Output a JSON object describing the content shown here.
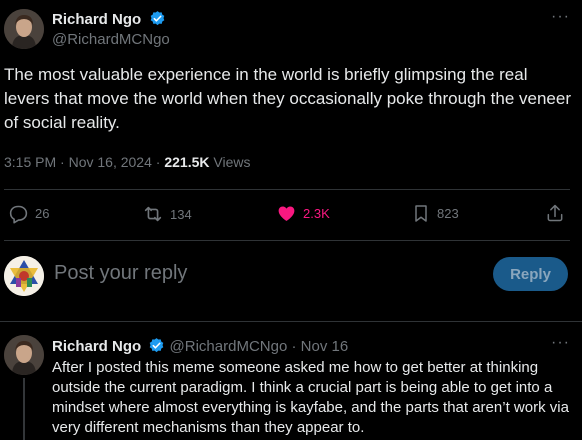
{
  "author": {
    "name": "Richard Ngo",
    "handle": "@RichardMCNgo"
  },
  "tweet": {
    "text": "The most valuable experience in the world is briefly glimpsing the real levers that move the world when they occasionally poke through the veneer of social reality.",
    "time": "3:15 PM",
    "date": "Nov 16, 2024",
    "views_count": "221.5K",
    "views_label": "Views"
  },
  "actions": {
    "replies": "26",
    "reposts": "134",
    "likes": "2.3K",
    "bookmarks": "823"
  },
  "composer": {
    "placeholder": "Post your reply",
    "button_label": "Reply"
  },
  "reply_tweet": {
    "name": "Richard Ngo",
    "handle": "@RichardMCNgo",
    "date": "Nov 16",
    "text": "After I posted this meme someone asked me how to get better at thinking outside the current paradigm. I think a crucial part is being able to get into a mindset where almost everything is kayfabe, and the parts that aren’t work via very different mechanisms than they appear to."
  },
  "colors": {
    "accent": "#1d9bf0",
    "like": "#f91880",
    "muted": "#71767b"
  },
  "icons": [
    "verified-badge-icon",
    "more-icon",
    "reply-icon",
    "repost-icon",
    "heart-icon",
    "bookmark-icon",
    "share-icon"
  ]
}
